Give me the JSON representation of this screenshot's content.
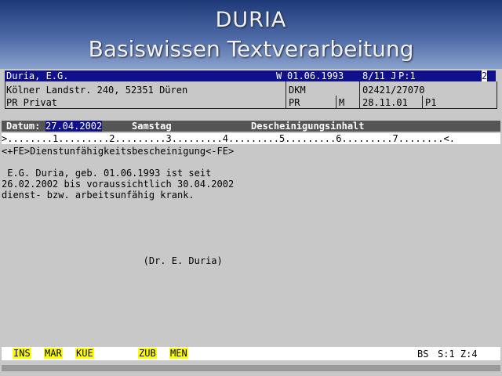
{
  "banner": {
    "line1": "DURIA",
    "line2": "Basiswissen Textverarbeitung"
  },
  "patient": {
    "name": "Duria, E.G.",
    "sex_flag": "W",
    "dob": "01.06.1993",
    "age": "8/11 J",
    "page": "P:1",
    "screen_no": "2",
    "address": "Kölner Landstr. 240, 52351 Düren",
    "insurer": "DKM",
    "phone": "02421/27070",
    "status": "PR Privat",
    "status_code": "PR",
    "member": "M",
    "last_date": "28.11.01",
    "p_code": "P1"
  },
  "datebar": {
    "date_label": "Datum:",
    "date_value": "27.04.2002",
    "weekday": "Samstag",
    "section": "Descheinigungsinhalt"
  },
  "ruler": {
    "text": ">........1.........2.........3.........4.........5.........6.........7........<."
  },
  "document": {
    "lines": [
      "<+FE>Dienstunfähigkeitsbescheinigung<-FE>",
      "",
      " E.G. Duria, geb. 01.06.1993 ist seit",
      "26.02.2002 bis voraussichtlich 30.04.2002",
      "dienst- bzw. arbeitsunfähig krank.",
      "",
      "",
      "",
      "",
      "",
      "                         (Dr. E. Duria)"
    ]
  },
  "statusbar": {
    "keys": [
      "INS",
      "MAR",
      "KUE",
      "ZUB",
      "MEN"
    ],
    "mode": "BS",
    "position": "S:1 Z:4"
  },
  "colors": {
    "header_blue": "#10108a",
    "function_key_yellow": "#ffff00",
    "terminal_gray": "#c8c8c8"
  }
}
